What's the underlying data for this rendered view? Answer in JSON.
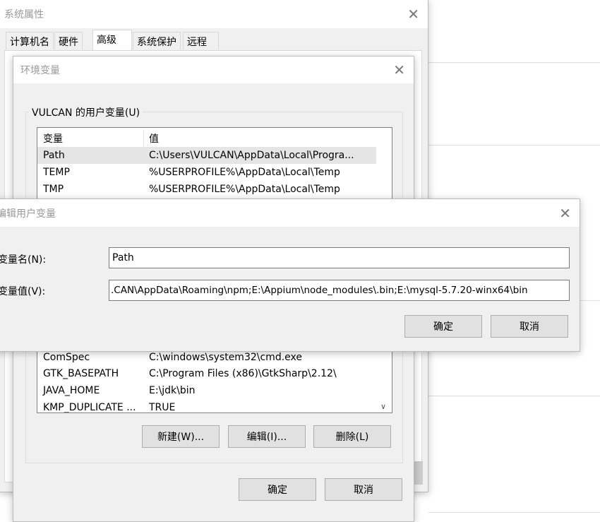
{
  "system_props": {
    "title": "系统属性",
    "tabs": [
      "计算机名",
      "硬件",
      "高级",
      "系统保护",
      "远程"
    ],
    "active_tab": "高级"
  },
  "env_dialog": {
    "title": "环境变量",
    "user_group_label": "VULCAN 的用户变量(U)",
    "columns": [
      "变量",
      "值"
    ],
    "rows_top": [
      {
        "name": "Path",
        "value": "C:\\Users\\VULCAN\\AppData\\Local\\Progra...",
        "selected": true
      },
      {
        "name": "TEMP",
        "value": "%USERPROFILE%\\AppData\\Local\\Temp"
      },
      {
        "name": "TMP",
        "value": "%USERPROFILE%\\AppData\\Local\\Temp"
      }
    ],
    "rows_bottom": [
      {
        "name": "ComSpec",
        "value": "C:\\windows\\system32\\cmd.exe"
      },
      {
        "name": "GTK_BASEPATH",
        "value": "C:\\Program Files (x86)\\GtkSharp\\2.12\\"
      },
      {
        "name": "JAVA_HOME",
        "value": "E:\\jdk\\bin"
      },
      {
        "name": "KMP_DUPLICATE ...",
        "value": "TRUE"
      }
    ],
    "new_label": "新建(W)...",
    "edit_label": "编辑(I)...",
    "delete_label": "删除(L)",
    "ok_label": "确定",
    "cancel_label": "取消"
  },
  "edit_dialog": {
    "title": "编辑用户变量",
    "name_label": "变量名(N):",
    "name_value": "Path",
    "value_label": "变量值(V):",
    "value_value": ".CAN\\AppData\\Roaming\\npm;E:\\Appium\\node_modules\\.bin;E:\\mysql-5.7.20-winx64\\bin",
    "ok_label": "确定",
    "cancel_label": "取消"
  },
  "colors": {
    "dialog_bg": "#f0f0f0",
    "selected_row": "#e5e5e5"
  }
}
